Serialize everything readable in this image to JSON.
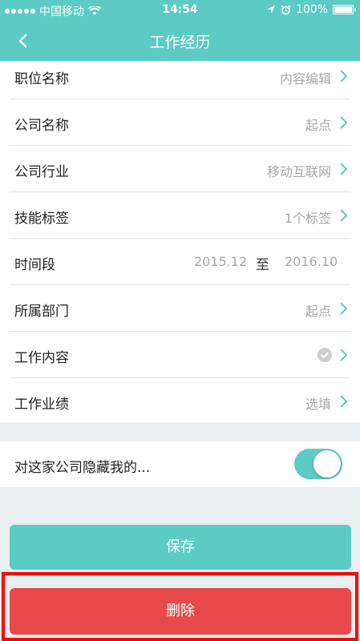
{
  "status_bar": {
    "carrier": "中国移动",
    "time": "14:54",
    "battery": "100%"
  },
  "nav": {
    "title": "工作经历"
  },
  "rows": [
    {
      "label": "职位名称",
      "value": "内容编辑"
    },
    {
      "label": "公司名称",
      "value": "起点"
    },
    {
      "label": "公司行业",
      "value": "移动互联网"
    },
    {
      "label": "技能标签",
      "value": "1个标签"
    },
    {
      "label": "时间段",
      "start": "2015.12",
      "separator": "至",
      "end": "2016.10"
    },
    {
      "label": "所属部门",
      "value": "起点"
    },
    {
      "label": "工作内容",
      "value": ""
    },
    {
      "label": "工作业绩",
      "value": "选填"
    }
  ],
  "hide_row": {
    "label": "对这家公司隐藏我的...",
    "toggle_on": true
  },
  "buttons": {
    "save": "保存",
    "delete": "删除"
  },
  "colors": {
    "accent": "#5ccbc3",
    "danger": "#e84a4b",
    "highlight": "#ff0000"
  }
}
